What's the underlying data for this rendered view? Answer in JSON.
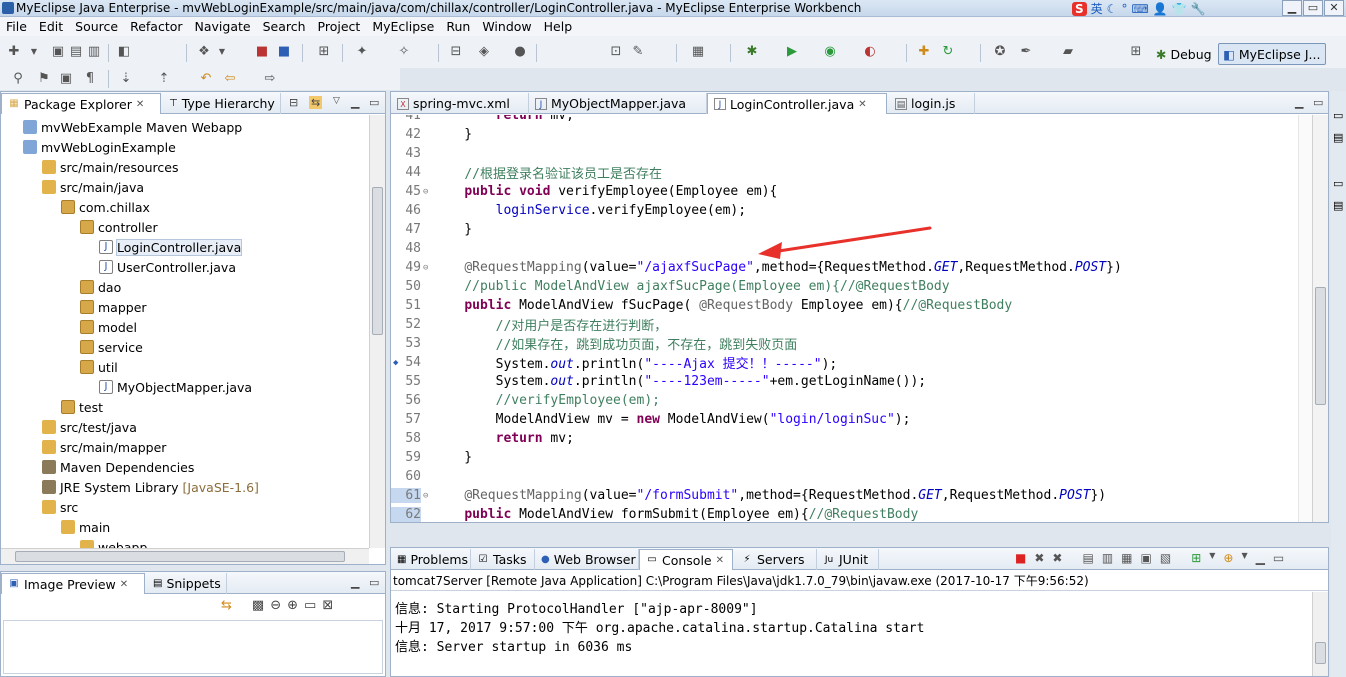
{
  "window": {
    "title": "MyEclipse Java Enterprise - mvWebLoginExample/src/main/java/com/chillax/controller/LoginController.java - MyEclipse Enterprise Workbench"
  },
  "ime": {
    "lang": "英",
    "glyphs": [
      "☾",
      "°",
      "⌨",
      "👤",
      "👕",
      "🔧"
    ]
  },
  "menu": [
    "File",
    "Edit",
    "Source",
    "Refactor",
    "Navigate",
    "Search",
    "Project",
    "MyEclipse",
    "Run",
    "Window",
    "Help"
  ],
  "perspectives": {
    "debug": "Debug",
    "myeclipse": "MyEclipse J..."
  },
  "package_explorer": {
    "tabs": [
      "Package Explorer",
      "Type Hierarchy"
    ],
    "items": [
      {
        "label": "mvWebExample Maven Webapp",
        "icon": "project-icon",
        "indent": 0
      },
      {
        "label": "mvWebLoginExample",
        "icon": "project-icon",
        "indent": 0
      },
      {
        "label": "src/main/resources",
        "icon": "source-folder-icon",
        "indent": 1
      },
      {
        "label": "src/main/java",
        "icon": "source-folder-icon",
        "indent": 1
      },
      {
        "label": "com.chillax",
        "icon": "package-icon",
        "indent": 2
      },
      {
        "label": "controller",
        "icon": "package-icon",
        "indent": 3
      },
      {
        "label": "LoginController.java",
        "icon": "java-file-icon",
        "indent": 4,
        "selected": true
      },
      {
        "label": "UserController.java",
        "icon": "java-file-icon",
        "indent": 4
      },
      {
        "label": "dao",
        "icon": "package-icon",
        "indent": 3
      },
      {
        "label": "mapper",
        "icon": "package-icon",
        "indent": 3
      },
      {
        "label": "model",
        "icon": "package-icon",
        "indent": 3
      },
      {
        "label": "service",
        "icon": "package-icon",
        "indent": 3
      },
      {
        "label": "util",
        "icon": "package-icon",
        "indent": 3
      },
      {
        "label": "MyObjectMapper.java",
        "icon": "java-file-icon",
        "indent": 4
      },
      {
        "label": "test",
        "icon": "package-icon",
        "indent": 2
      },
      {
        "label": "src/test/java",
        "icon": "source-folder-icon",
        "indent": 1
      },
      {
        "label": "src/main/mapper",
        "icon": "source-folder-icon",
        "indent": 1
      },
      {
        "label": "Maven Dependencies",
        "icon": "library-icon",
        "indent": 1
      },
      {
        "label": "JRE System Library",
        "decoration": "[JavaSE-1.6]",
        "icon": "library-icon",
        "indent": 1
      },
      {
        "label": "src",
        "icon": "folder-icon",
        "indent": 1
      },
      {
        "label": "main",
        "icon": "folder-icon",
        "indent": 2
      },
      {
        "label": "webapp",
        "icon": "folder-icon",
        "indent": 3
      }
    ]
  },
  "image_preview": {
    "tabs": [
      "Image Preview",
      "Snippets"
    ]
  },
  "editor": {
    "tabs": [
      "spring-mvc.xml",
      "MyObjectMapper.java",
      "LoginController.java",
      "login.js"
    ],
    "active_tab": "LoginController.java",
    "lines": [
      {
        "n": "41",
        "html": "        <span class=\"kw\">return</span> mv;"
      },
      {
        "n": "42",
        "html": "    }"
      },
      {
        "n": "43",
        "html": ""
      },
      {
        "n": "44",
        "html": "    <span class=\"cm\">//根据登录名验证该员工是否存在</span>"
      },
      {
        "n": "45",
        "html": "    <span class=\"kw\">public void</span> verifyEmployee(Employee em){",
        "fold": true
      },
      {
        "n": "46",
        "html": "        <span class=\"fld\">loginService</span>.verifyEmployee(em);"
      },
      {
        "n": "47",
        "html": "    }"
      },
      {
        "n": "48",
        "html": ""
      },
      {
        "n": "49",
        "html": "    <span class=\"an\">@RequestMapping</span>(value=<span class=\"str\">\"/ajaxfSucPage\"</span>,method={RequestMethod.<span class=\"it\">GET</span>,RequestMethod.<span class=\"it\">POST</span>})",
        "fold": true
      },
      {
        "n": "50",
        "html": "    <span class=\"cm\">//public ModelAndView ajaxfSucPage(Employee em){//@RequestBody</span>"
      },
      {
        "n": "51",
        "html": "    <span class=\"kw\">public</span> ModelAndView fSucPage( <span class=\"an\">@RequestBody</span> Employee em){<span class=\"cm\">//@RequestBody</span>"
      },
      {
        "n": "52",
        "html": "        <span class=\"cm\">//对用户是否存在进行判断，</span>"
      },
      {
        "n": "53",
        "html": "        <span class=\"cm\">//如果存在，跳到成功页面，不存在，跳到失败页面</span>"
      },
      {
        "n": "54",
        "html": "        System.<span class=\"it\">out</span>.println(<span class=\"str\">\"----Ajax 提交！！-----\"</span>);",
        "marker": true
      },
      {
        "n": "55",
        "html": "        System.<span class=\"it\">out</span>.println(<span class=\"str\">\"----123em-----\"</span>+em.getLoginName());"
      },
      {
        "n": "56",
        "html": "        <span class=\"cm\">//verifyEmployee(em);</span>"
      },
      {
        "n": "57",
        "html": "        ModelAndView mv = <span class=\"kw\">new</span> ModelAndView(<span class=\"str\">\"login/loginSuc\"</span>);"
      },
      {
        "n": "58",
        "html": "        <span class=\"kw\">return</span> mv;"
      },
      {
        "n": "59",
        "html": "    }"
      },
      {
        "n": "60",
        "html": ""
      },
      {
        "n": "61",
        "html": "    <span class=\"an\">@RequestMapping</span>(value=<span class=\"str\">\"/formSubmit\"</span>,method={RequestMethod.<span class=\"it\">GET</span>,RequestMethod.<span class=\"it\">POST</span>})",
        "fold": true,
        "hl": true
      },
      {
        "n": "62",
        "html": "    <span class=\"kw\">public</span> ModelAndView formSubmit(Employee em){<span class=\"cm\">//@RequestBody</span>",
        "hl": true
      }
    ]
  },
  "console_view": {
    "tabs": [
      "Problems",
      "Tasks",
      "Web Browser",
      "Console",
      "Servers",
      "JUnit"
    ],
    "active_tab": "Console",
    "header": "tomcat7Server [Remote Java Application] C:\\Program Files\\Java\\jdk1.7.0_79\\bin\\javaw.exe (2017-10-17 下午9:56:52)",
    "lines": [
      "信息: Starting ProtocolHandler [\"ajp-apr-8009\"]",
      "十月 17, 2017 9:57:00 下午 org.apache.catalina.startup.Catalina start",
      "信息: Server startup in 6036 ms"
    ]
  },
  "colors": {
    "keyword": "#7f0055",
    "string": "#2a00ff",
    "comment": "#3f7f5f",
    "annotation": "#646464",
    "arrow": "#e8312a"
  }
}
